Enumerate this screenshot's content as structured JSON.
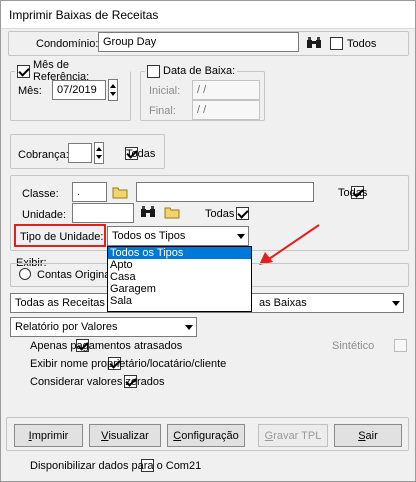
{
  "window": {
    "title": "Imprimir Baixas de Receitas"
  },
  "condominio": {
    "label": "Condomínio:",
    "value": "Group Day",
    "todos_label": "Todos"
  },
  "mes_referencia": {
    "label": "Mês de Referência:",
    "mes_label": "Mês:",
    "mes_value": "07/2019"
  },
  "data_baixa": {
    "label": "Data de Baixa:",
    "inicial_label": "Inicial:",
    "inicial_value": " /  /",
    "final_label": "Final:",
    "final_value": " /  /"
  },
  "cobranca": {
    "label": "Cobrança:",
    "value": "",
    "todas_label": "Todas"
  },
  "classe": {
    "label": "Classe:",
    "code_value": ".",
    "desc_value": "",
    "todas_label": "Todas"
  },
  "unidade": {
    "label": "Unidade:",
    "value": "",
    "todas_label": "Todas"
  },
  "tipo_unidade": {
    "label": "Tipo de Unidade:",
    "selected": "Todos os Tipos",
    "options": [
      "Todos os Tipos",
      "Apto",
      "Casa",
      "Garagem",
      "Sala"
    ]
  },
  "exibir": {
    "label": "Exibir:",
    "contas_originais": "Contas Origina"
  },
  "receitas_select": {
    "value": "Todas as Receitas"
  },
  "baixas_select": {
    "value": "as Baixas"
  },
  "relatorio_select": {
    "value": "Relatório por Valores"
  },
  "options": {
    "apenas_atrasados": "Apenas pagamentos atrasados",
    "exibir_nome": "Exibir nome proprietário/locatário/cliente",
    "considerar_zerados": "Considerar valores zerados",
    "sintetico": "Sintético"
  },
  "buttons": {
    "imprimir_u": "I",
    "imprimir_rest": "mprimir",
    "visualizar_u": "V",
    "visualizar_rest": "isualizar",
    "configuracao_u": "C",
    "configuracao_rest": "onfiguração",
    "gravar_tpl_u": "G",
    "gravar_tpl_rest": "ravar TPL",
    "sair_u": "S",
    "sair_rest": "air"
  },
  "disponibilizar": "Disponibilizar dados para o Com21",
  "colors": {
    "highlight": "#0078d7",
    "annotation_red": "#e32020"
  }
}
